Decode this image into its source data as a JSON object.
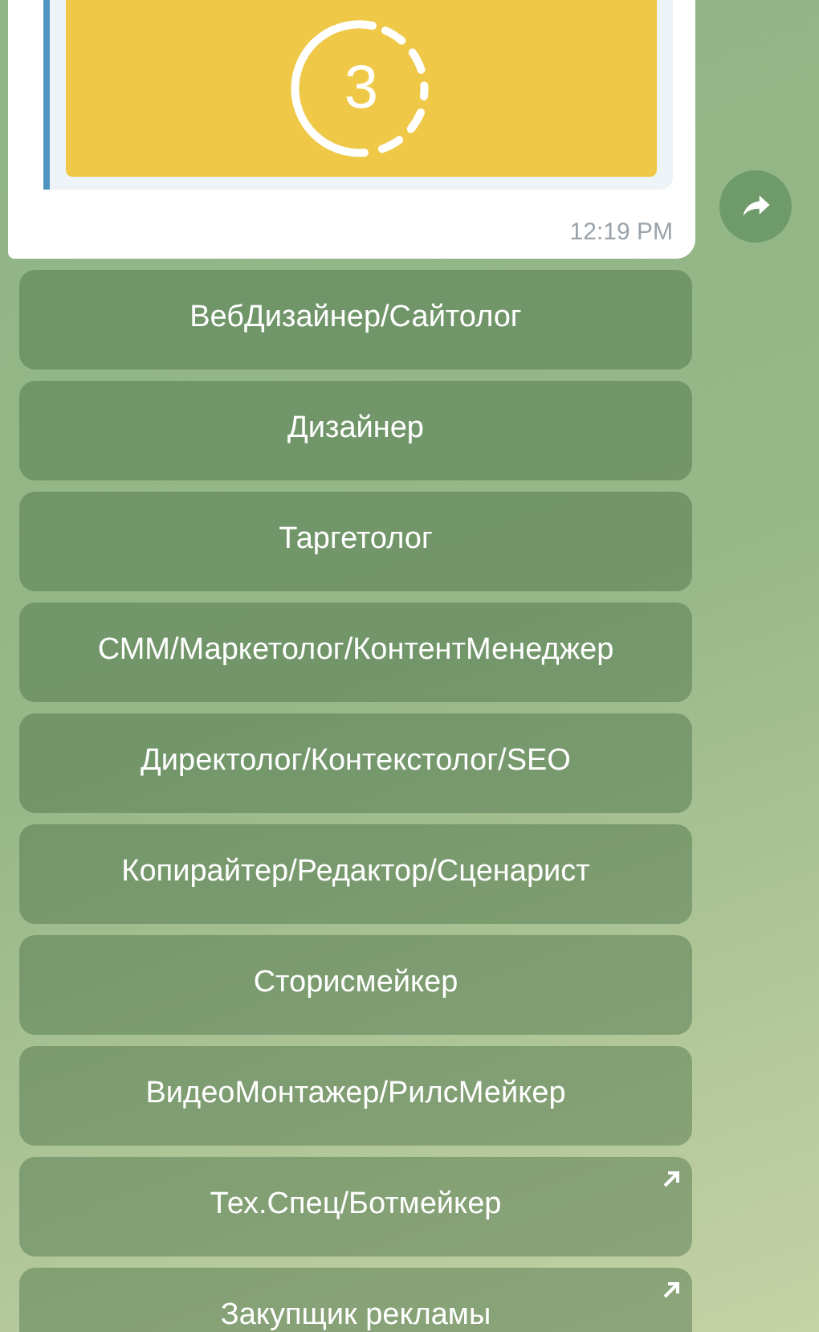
{
  "message": {
    "countdown": "3",
    "time": "12:19 PM"
  },
  "keyboard": [
    {
      "label": "ВебДизайнер/Сайтолог",
      "kind": "callback"
    },
    {
      "label": "Дизайнер",
      "kind": "callback"
    },
    {
      "label": "Таргетолог",
      "kind": "callback"
    },
    {
      "label": "СММ/Маркетолог/КонтентМенеджер",
      "kind": "callback"
    },
    {
      "label": "Директолог/Контекстолог/SEO",
      "kind": "callback"
    },
    {
      "label": "Копирайтер/Редактор/Сценарист",
      "kind": "callback"
    },
    {
      "label": "Сторисмейкер",
      "kind": "callback"
    },
    {
      "label": "ВидеоМонтажер/РилсМейкер",
      "kind": "callback"
    },
    {
      "label": "Тех.Спец/Ботмейкер",
      "kind": "url"
    },
    {
      "label": "Закупщик рекламы",
      "kind": "url"
    }
  ]
}
